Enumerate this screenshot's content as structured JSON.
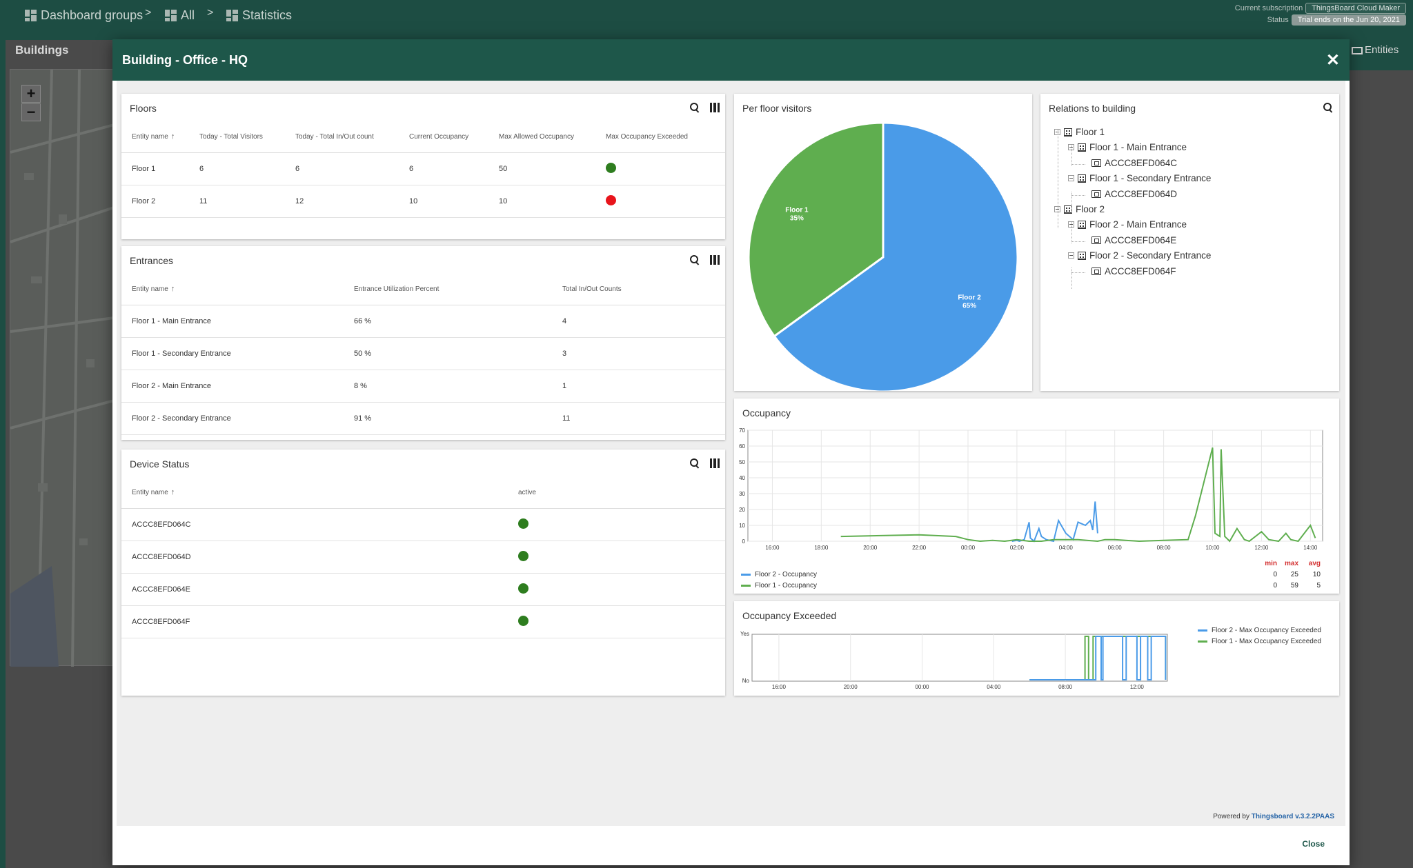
{
  "breadcrumb": {
    "items": [
      {
        "label": "Dashboard groups",
        "icon": "dashboard-grid-icon"
      },
      {
        "label": "All",
        "icon": "dashboard-grid-icon"
      },
      {
        "label": "Statistics",
        "icon": "dashboard-grid-icon"
      }
    ],
    "separator": ">"
  },
  "subscription": {
    "label": "Current subscription",
    "value": "ThingsBoard Cloud Maker",
    "status_label": "Status",
    "status_value": "Trial ends on the Jun 20, 2021"
  },
  "background": {
    "panel_title": "Buildings",
    "entities_label": "Entities",
    "zoom_in": "+",
    "zoom_out": "−"
  },
  "dialog": {
    "title": "Building - Office - HQ",
    "close_label": "Close",
    "powered_prefix": "Powered by",
    "powered_link": "Thingsboard v.3.2.2PAAS"
  },
  "floors": {
    "title": "Floors",
    "columns": [
      "Entity name",
      "Today - Total Visitors",
      "Today - Total In/Out count",
      "Current Occupancy",
      "Max Allowed Occupancy",
      "Max Occupancy Exceeded"
    ],
    "rows": [
      {
        "name": "Floor 1",
        "visitors": "6",
        "inout": "6",
        "occupancy": "6",
        "max": "50",
        "exceeded_color": "#2e7d1f"
      },
      {
        "name": "Floor 2",
        "visitors": "11",
        "inout": "12",
        "occupancy": "10",
        "max": "10",
        "exceeded_color": "#e8141b"
      }
    ]
  },
  "entrances": {
    "title": "Entrances",
    "columns": [
      "Entity name",
      "Entrance Utilization Percent",
      "Total In/Out Counts"
    ],
    "rows": [
      {
        "name": "Floor 1 - Main Entrance",
        "util": "66 %",
        "counts": "4"
      },
      {
        "name": "Floor 1 - Secondary Entrance",
        "util": "50 %",
        "counts": "3"
      },
      {
        "name": "Floor 2 - Main Entrance",
        "util": "8 %",
        "counts": "1"
      },
      {
        "name": "Floor 2 - Secondary Entrance",
        "util": "91 %",
        "counts": "11"
      }
    ]
  },
  "devices": {
    "title": "Device Status",
    "columns": [
      "Entity name",
      "active"
    ],
    "rows": [
      {
        "name": "ACCC8EFD064C",
        "color": "#2e7d1f"
      },
      {
        "name": "ACCC8EFD064D",
        "color": "#2e7d1f"
      },
      {
        "name": "ACCC8EFD064E",
        "color": "#2e7d1f"
      },
      {
        "name": "ACCC8EFD064F",
        "color": "#2e7d1f"
      }
    ]
  },
  "relations": {
    "title": "Relations to building",
    "tree": [
      {
        "label": "Floor 1",
        "icon": "building-icon",
        "level": 0
      },
      {
        "label": "Floor 1 - Main Entrance",
        "icon": "building-icon",
        "level": 1
      },
      {
        "label": "ACCC8EFD064C",
        "icon": "device-icon",
        "level": 2
      },
      {
        "label": "Floor 1 - Secondary Entrance",
        "icon": "building-icon",
        "level": 1
      },
      {
        "label": "ACCC8EFD064D",
        "icon": "device-icon",
        "level": 2
      },
      {
        "label": "Floor 2",
        "icon": "building-icon",
        "level": 0
      },
      {
        "label": "Floor 2 - Main Entrance",
        "icon": "building-icon",
        "level": 1
      },
      {
        "label": "ACCC8EFD064E",
        "icon": "device-icon",
        "level": 2
      },
      {
        "label": "Floor 2 - Secondary Entrance",
        "icon": "building-icon",
        "level": 1
      },
      {
        "label": "ACCC8EFD064F",
        "icon": "device-icon",
        "level": 2
      }
    ]
  },
  "colors": {
    "blue": "#4a9be8",
    "green": "#5fae4f",
    "header": "#1e574a"
  },
  "chart_data": [
    {
      "type": "pie",
      "title": "Per floor visitors",
      "slices": [
        {
          "name": "Floor 2",
          "value": 65,
          "label": "65%",
          "color": "#4a9be8"
        },
        {
          "name": "Floor 1",
          "value": 35,
          "label": "35%",
          "color": "#5fae4f"
        }
      ]
    },
    {
      "type": "line",
      "title": "Occupancy",
      "ylim": [
        0,
        70
      ],
      "yticks": [
        "0",
        "10",
        "20",
        "30",
        "40",
        "50",
        "60",
        "70"
      ],
      "xticks": [
        "16:00",
        "18:00",
        "20:00",
        "22:00",
        "00:00",
        "02:00",
        "04:00",
        "06:00",
        "08:00",
        "10:00",
        "12:00",
        "14:00"
      ],
      "stats_headers": [
        "min",
        "max",
        "avg"
      ],
      "series": [
        {
          "name": "Floor 2 - Occupancy",
          "color": "#4a9be8",
          "min": "0",
          "max": "25",
          "avg": "10",
          "points": [
            [
              25.8,
              0
            ],
            [
              26.0,
              0.5
            ],
            [
              26.1,
              0
            ],
            [
              26.3,
              1
            ],
            [
              26.5,
              12
            ],
            [
              26.55,
              2
            ],
            [
              26.7,
              0
            ],
            [
              26.9,
              8
            ],
            [
              27.0,
              3
            ],
            [
              27.2,
              1
            ],
            [
              27.5,
              0
            ],
            [
              27.7,
              13
            ],
            [
              28.0,
              5
            ],
            [
              28.3,
              1
            ],
            [
              28.5,
              12
            ],
            [
              28.8,
              10
            ],
            [
              29.0,
              13
            ],
            [
              29.1,
              7
            ],
            [
              29.2,
              25
            ],
            [
              29.3,
              5
            ]
          ]
        },
        {
          "name": "Floor 1 - Occupancy",
          "color": "#5fae4f",
          "min": "0",
          "max": "59",
          "avg": "5",
          "points": [
            [
              18.8,
              3
            ],
            [
              22.0,
              4
            ],
            [
              23.5,
              3
            ],
            [
              24.0,
              1
            ],
            [
              24.5,
              0
            ],
            [
              25.0,
              0.5
            ],
            [
              25.5,
              0
            ],
            [
              26.0,
              1
            ],
            [
              26.5,
              0
            ],
            [
              27.0,
              0
            ],
            [
              27.5,
              1
            ],
            [
              28.5,
              1
            ],
            [
              29.3,
              0
            ],
            [
              29.6,
              1
            ],
            [
              30.0,
              1
            ],
            [
              31.0,
              0
            ],
            [
              32.0,
              0.5
            ],
            [
              33.0,
              1
            ],
            [
              33.3,
              16
            ],
            [
              34.0,
              59
            ],
            [
              34.1,
              5
            ],
            [
              34.3,
              3
            ],
            [
              34.35,
              58
            ],
            [
              34.5,
              3
            ],
            [
              34.7,
              0
            ],
            [
              35.0,
              8
            ],
            [
              35.3,
              1
            ],
            [
              35.5,
              0
            ],
            [
              36.0,
              6
            ],
            [
              36.3,
              1
            ],
            [
              36.7,
              0
            ],
            [
              37.0,
              5
            ],
            [
              37.2,
              1
            ],
            [
              37.5,
              0
            ],
            [
              38.0,
              10
            ],
            [
              38.2,
              2
            ]
          ]
        }
      ]
    },
    {
      "type": "line",
      "title": "Occupancy Exceeded",
      "yticks": [
        "No",
        "Yes"
      ],
      "xticks": [
        "16:00",
        "20:00",
        "00:00",
        "04:00",
        "08:00",
        "12:00"
      ],
      "series": [
        {
          "name": "Floor 2 - Max Occupancy Exceeded",
          "color": "#4a9be8"
        },
        {
          "name": "Floor 1 - Max Occupancy Exceeded",
          "color": "#5fae4f"
        }
      ]
    }
  ]
}
